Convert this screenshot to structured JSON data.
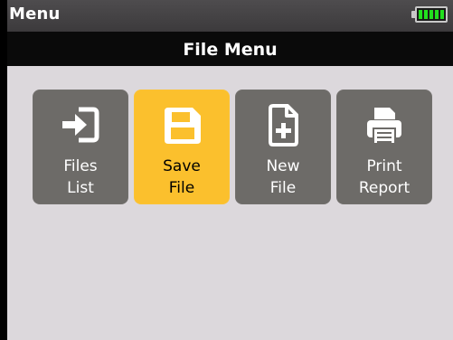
{
  "status_bar": {
    "title": "Menu",
    "battery_level": 1.0,
    "battery_color": "#22e01e"
  },
  "header": {
    "title": "File Menu"
  },
  "menu": {
    "selected_index": 1,
    "selected_color": "#fbc02d",
    "tile_color": "#6d6b68",
    "items": [
      {
        "icon": "sign-in-icon",
        "line1": "Files",
        "line2": "List"
      },
      {
        "icon": "save-icon",
        "line1": "Save",
        "line2": "File"
      },
      {
        "icon": "new-file-icon",
        "line1": "New",
        "line2": "File"
      },
      {
        "icon": "printer-icon",
        "line1": "Print",
        "line2": "Report"
      }
    ]
  }
}
